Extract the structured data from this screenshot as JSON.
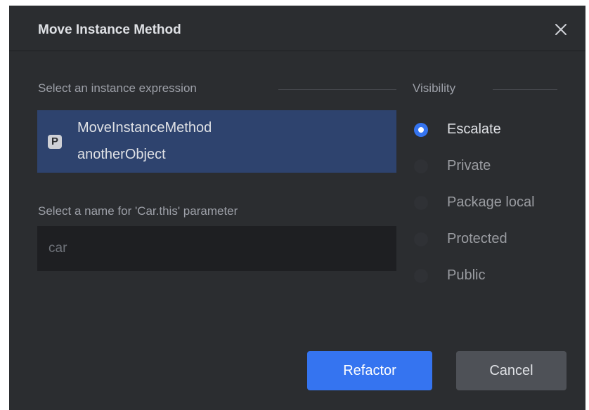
{
  "dialog": {
    "title": "Move Instance Method",
    "close_icon": "close-icon"
  },
  "expression_section": {
    "label": "Select an instance expression",
    "items": [
      {
        "badge": "P",
        "line1": "MoveInstanceMethod",
        "line2": "anotherObject",
        "selected": true
      }
    ]
  },
  "name_section": {
    "label": "Select a name for 'Car.this' parameter",
    "input_value": "",
    "input_placeholder": "car"
  },
  "visibility": {
    "label": "Visibility",
    "options": [
      {
        "label": "Escalate",
        "checked": true
      },
      {
        "label": "Private",
        "checked": false
      },
      {
        "label": "Package local",
        "checked": false
      },
      {
        "label": "Protected",
        "checked": false
      },
      {
        "label": "Public",
        "checked": false
      }
    ]
  },
  "buttons": {
    "refactor_label": "Refactor",
    "cancel_label": "Cancel"
  },
  "colors": {
    "background": "#2b2d30",
    "accent": "#3574f0",
    "selection": "#2e436e",
    "input_background": "#1e1f22"
  }
}
